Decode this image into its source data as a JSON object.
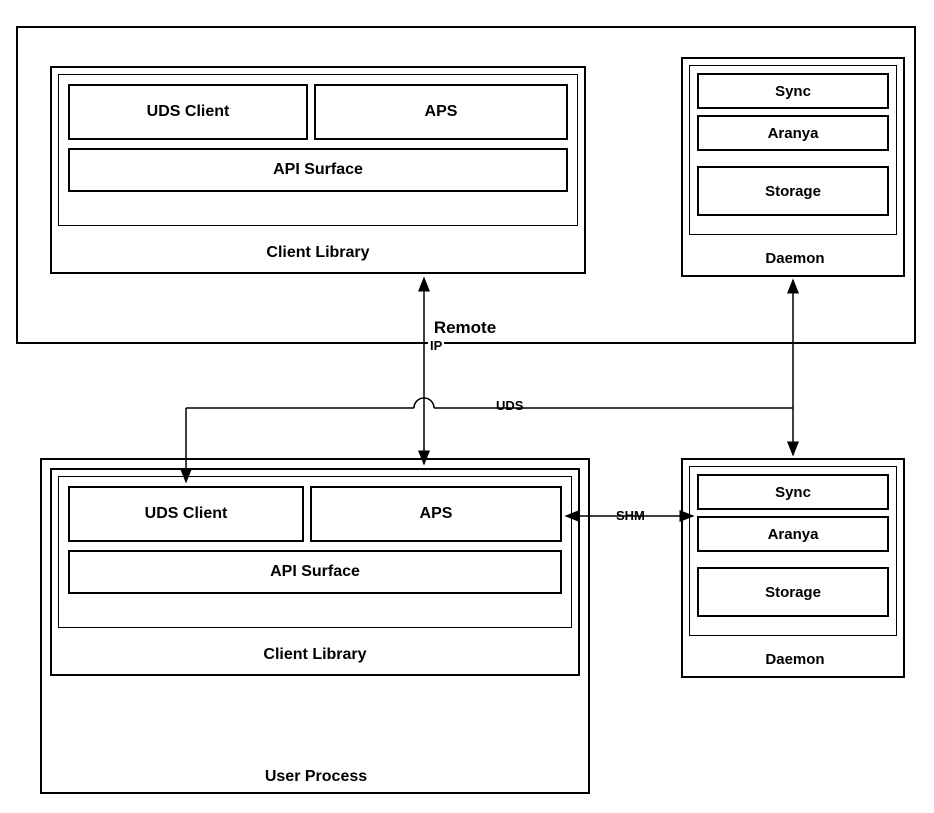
{
  "remote": {
    "title": "Remote",
    "client_library": {
      "title": "Client Library",
      "uds_client": "UDS Client",
      "aps": "APS",
      "api_surface": "API Surface"
    },
    "daemon": {
      "title": "Daemon",
      "sync": "Sync",
      "aranya": "Aranya",
      "storage": "Storage"
    }
  },
  "user_process": {
    "title": "User Process",
    "client_library": {
      "title": "Client Library",
      "uds_client": "UDS Client",
      "aps": "APS",
      "api_surface": "API Surface"
    }
  },
  "daemon_bottom": {
    "title": "Daemon",
    "sync": "Sync",
    "aranya": "Aranya",
    "storage": "Storage"
  },
  "connections": {
    "ip": "IP",
    "uds": "UDS",
    "shm": "SHM"
  }
}
